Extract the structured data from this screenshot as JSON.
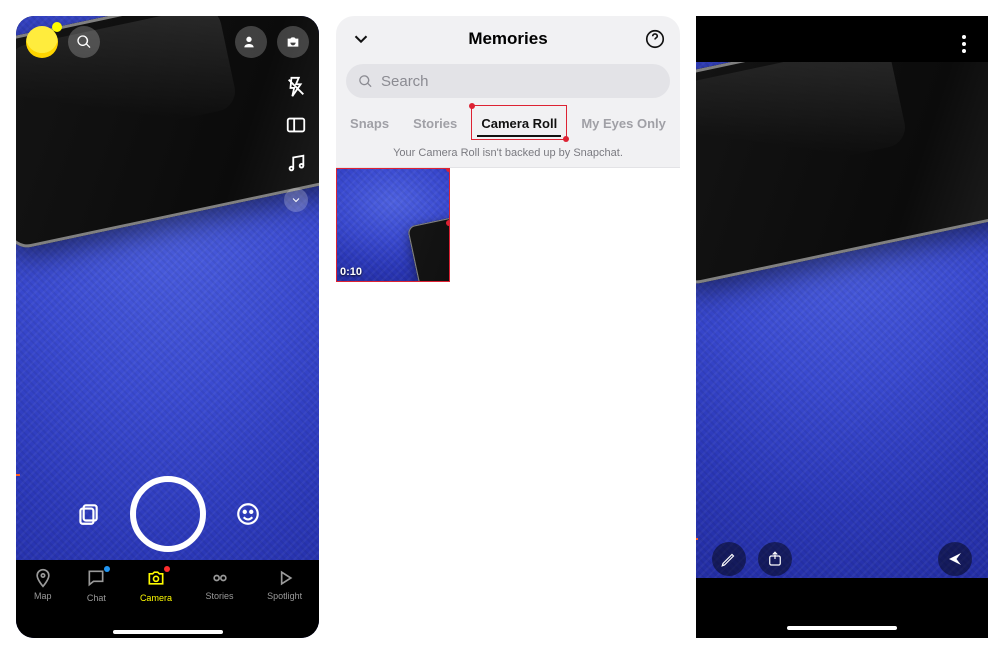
{
  "panel1": {
    "nav": {
      "map": "Map",
      "chat": "Chat",
      "camera": "Camera",
      "stories": "Stories",
      "spotlight": "Spotlight"
    }
  },
  "panel2": {
    "title": "Memories",
    "search_placeholder": "Search",
    "tabs": {
      "snaps": "Snaps",
      "stories": "Stories",
      "camera_roll": "Camera Roll",
      "my_eyes_only": "My Eyes Only"
    },
    "info": "Your Camera Roll isn't backed up by Snapchat.",
    "items": [
      {
        "duration": "0:10"
      }
    ]
  }
}
